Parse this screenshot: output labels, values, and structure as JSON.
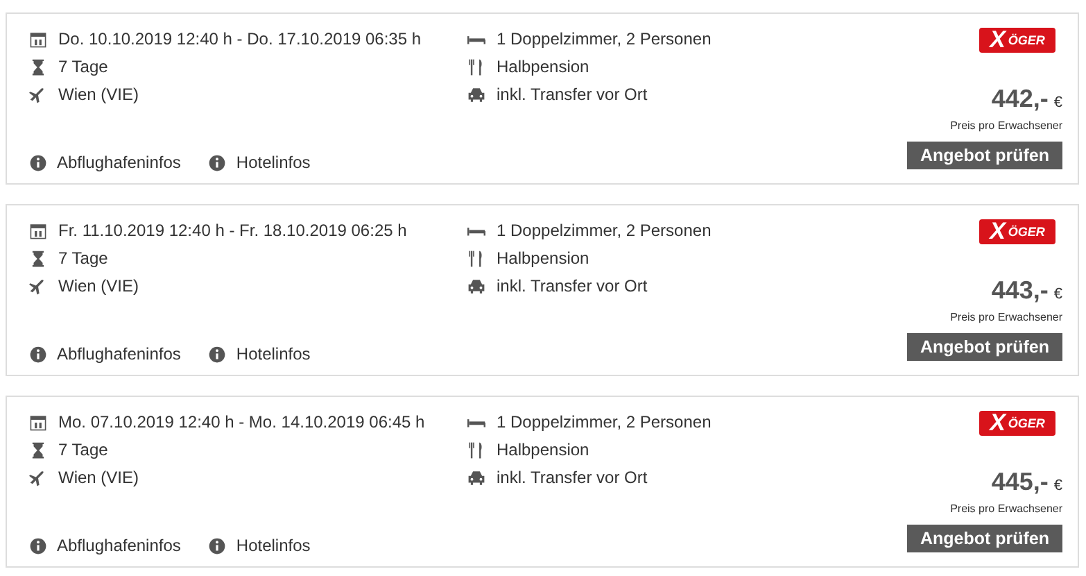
{
  "offers": [
    {
      "dates": "Do. 10.10.2019 12:40 h - Do. 17.10.2019 06:35 h",
      "duration": "7 Tage",
      "airport": "Wien (VIE)",
      "room": "1 Doppelzimmer, 2 Personen",
      "board": "Halbpension",
      "transfer": "inkl. Transfer vor Ort",
      "logo": {
        "mark": "X",
        "name": "ÖGER"
      },
      "price": "442,-",
      "currency": "€",
      "price_note": "Preis pro Erwachsener",
      "button": "Angebot prüfen",
      "links": [
        "Abflughafeninfos",
        "Hotelinfos"
      ]
    },
    {
      "dates": "Fr. 11.10.2019 12:40 h - Fr. 18.10.2019 06:25 h",
      "duration": "7 Tage",
      "airport": "Wien (VIE)",
      "room": "1 Doppelzimmer, 2 Personen",
      "board": "Halbpension",
      "transfer": "inkl. Transfer vor Ort",
      "logo": {
        "mark": "X",
        "name": "ÖGER"
      },
      "price": "443,-",
      "currency": "€",
      "price_note": "Preis pro Erwachsener",
      "button": "Angebot prüfen",
      "links": [
        "Abflughafeninfos",
        "Hotelinfos"
      ]
    },
    {
      "dates": "Mo. 07.10.2019 12:40 h - Mo. 14.10.2019 06:45 h",
      "duration": "7 Tage",
      "airport": "Wien (VIE)",
      "room": "1 Doppelzimmer, 2 Personen",
      "board": "Halbpension",
      "transfer": "inkl. Transfer vor Ort",
      "logo": {
        "mark": "X",
        "name": "ÖGER"
      },
      "price": "445,-",
      "currency": "€",
      "price_note": "Preis pro Erwachsener",
      "button": "Angebot prüfen",
      "links": [
        "Abflughafeninfos",
        "Hotelinfos"
      ]
    }
  ]
}
